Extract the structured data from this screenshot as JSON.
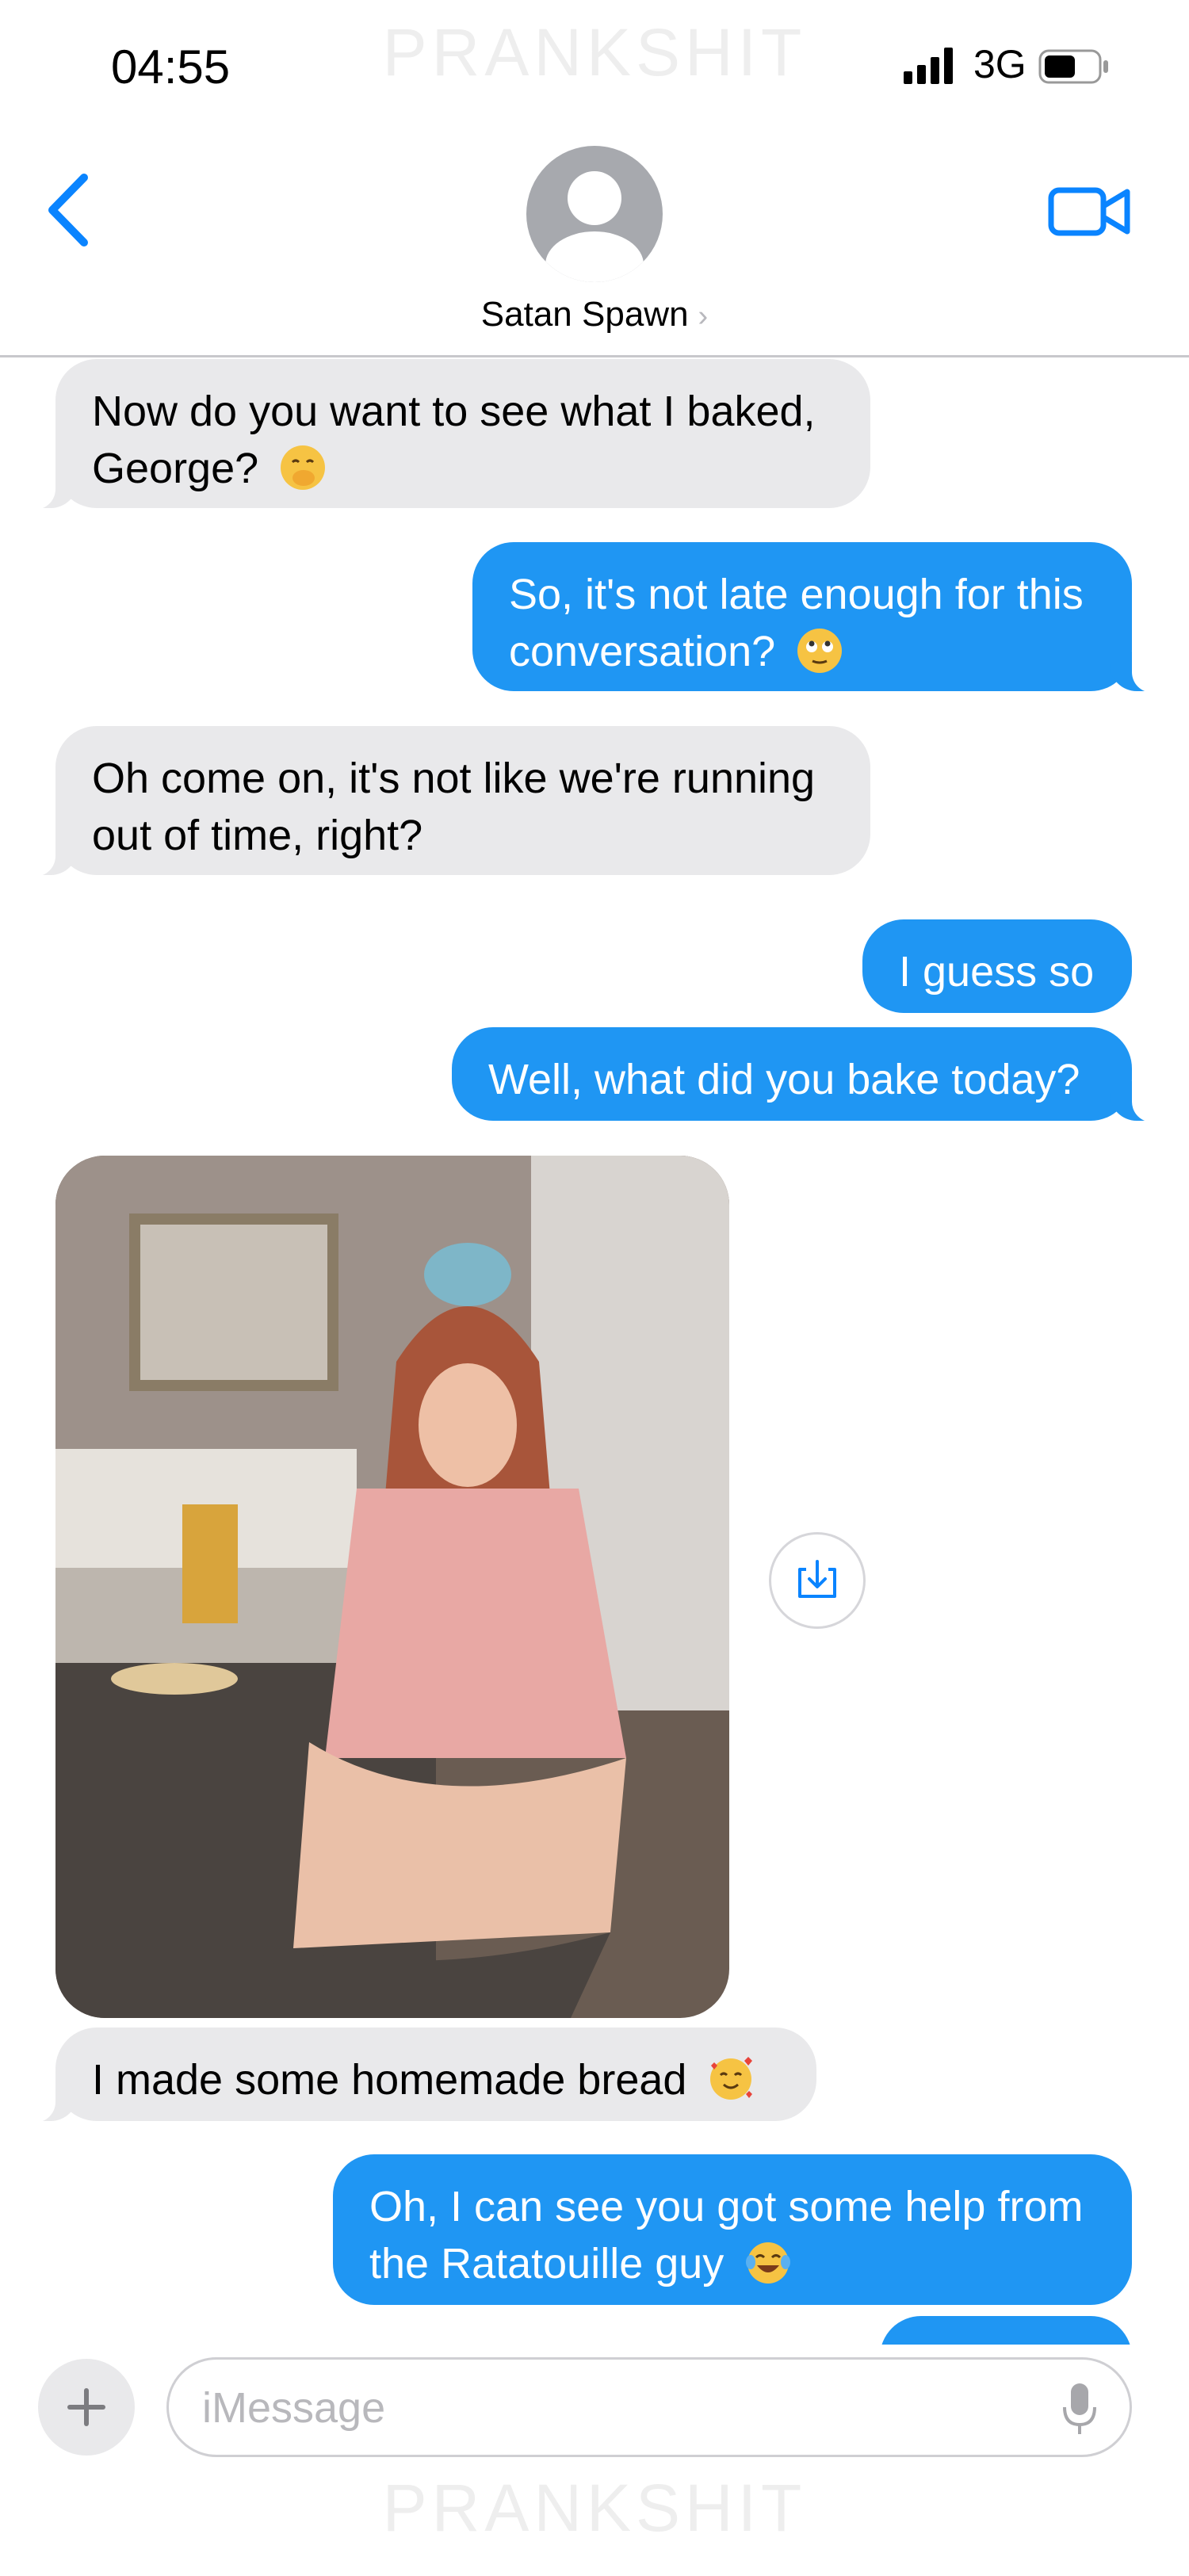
{
  "status_bar": {
    "time": "04:55",
    "network": "3G"
  },
  "watermark": {
    "text": "PRANKSHIT"
  },
  "header": {
    "contact_name": "Satan Spawn",
    "chevron": "›"
  },
  "messages": [
    {
      "direction": "received",
      "text": "Now do you want to see what I baked, George?",
      "emoji": "face-with-hand-over-mouth"
    },
    {
      "direction": "sent",
      "text": "So, it's not late enough for this conversation?",
      "emoji": "face-with-rolling-eyes"
    },
    {
      "direction": "received",
      "text": "Oh come on, it's not like we're running out of time, right?"
    },
    {
      "direction": "sent",
      "text": "I guess so"
    },
    {
      "direction": "sent",
      "text": "Well, what did you bake today?"
    },
    {
      "direction": "received",
      "type": "photo",
      "description_icon": "kitchen-photo"
    },
    {
      "direction": "received",
      "text": "I made some homemade bread",
      "emoji": "smiling-face-with-hearts"
    },
    {
      "direction": "sent",
      "text": "Oh, I can see you got some help from the Ratatouille guy",
      "emoji": "face-with-tears-of-joy"
    }
  ],
  "compose": {
    "placeholder": "iMessage"
  },
  "colors": {
    "accent": "#1f96f3",
    "incoming_bubble": "#e9e9eb",
    "icon_blue": "#0a84ff"
  }
}
